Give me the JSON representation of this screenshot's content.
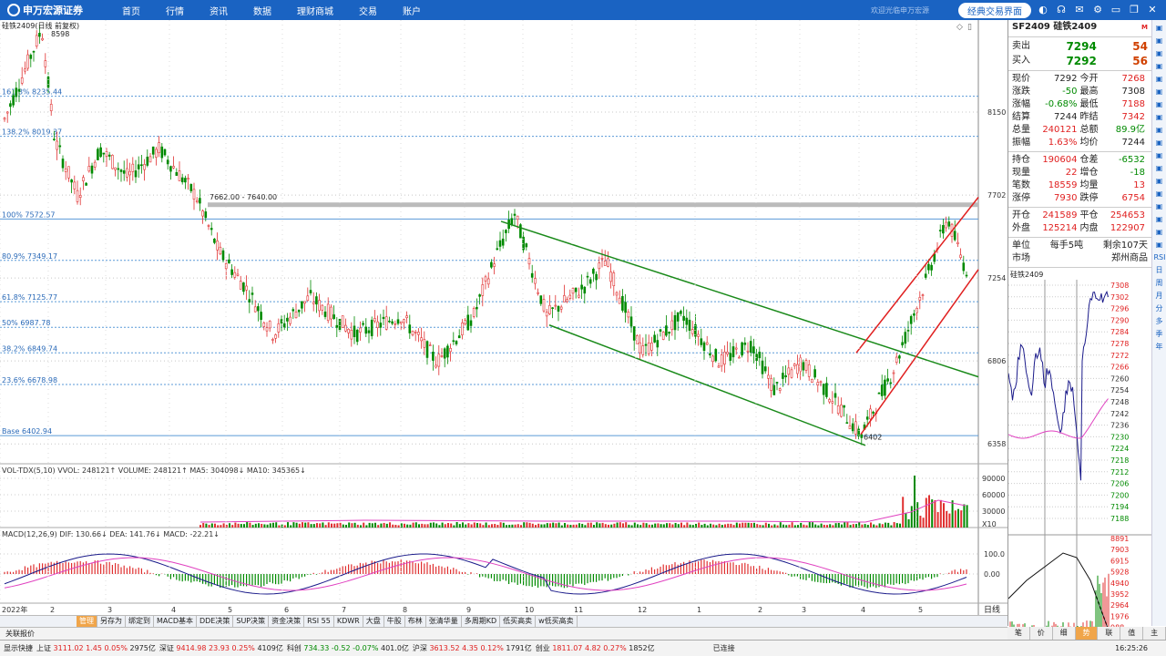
{
  "app": {
    "logo_text": "申万宏源证券",
    "nav": [
      "首页",
      "行情",
      "资讯",
      "数据",
      "理财商城",
      "交易",
      "账户"
    ],
    "welcome": "欢迎光临申万宏源",
    "classic_btn": "经典交易界面"
  },
  "chart": {
    "title": "硅铁2409(日线 前复权)",
    "high_label": "8598",
    "low_label": "6402",
    "zone_label": "7662.00 - 7640.00",
    "fib": [
      {
        "label": "161.8% 8235.44",
        "value": 8235.44
      },
      {
        "label": "138.2% 8019.37",
        "value": 8019.37
      },
      {
        "label": "100% 7572.57",
        "value": 7572.57
      },
      {
        "label": "80.9% 7349.17",
        "value": 7349.17
      },
      {
        "label": "61.8% 7125.77",
        "value": 7125.77
      },
      {
        "label": "50% 6987.78",
        "value": 6987.78
      },
      {
        "label": "38.2% 6849.74",
        "value": 6849.74
      },
      {
        "label": "23.6% 6678.98",
        "value": 6678.98
      },
      {
        "label": "Base 6402.94",
        "value": 6402.94
      }
    ],
    "y_ticks": [
      "8150",
      "7702",
      "7254",
      "6806",
      "6358"
    ],
    "vol_title": "VOL-TDX(5,10) VVOL: 248121↑ VOLUME: 248121↑ MA5: 304098↓ MA10: 345365↓",
    "vol_ticks": [
      "90000",
      "60000",
      "30000",
      "X10"
    ],
    "macd_title": "MACD(12,26,9) DIF: 130.66↓ DEA: 141.76↓ MACD: -22.21↓",
    "macd_ticks": [
      "100.0",
      "0.00"
    ],
    "x_labels": [
      "2022年",
      "2",
      "3",
      "4",
      "5",
      "6",
      "7",
      "8",
      "9",
      "10",
      "11",
      "12",
      "1",
      "2",
      "3",
      "4",
      "5"
    ],
    "period": "日线"
  },
  "quote": {
    "code": "SF2409 硅铁2409",
    "sell_label": "卖出",
    "sell_price": "7294",
    "sell_vol": "54",
    "buy_label": "买入",
    "buy_price": "7292",
    "buy_vol": "56",
    "rows1": [
      [
        "现价",
        "7292",
        "今开",
        "7268"
      ],
      [
        "涨跌",
        "-50",
        "最高",
        "7308"
      ],
      [
        "涨幅",
        "-0.68%",
        "最低",
        "7188"
      ],
      [
        "结算",
        "7244",
        "昨结",
        "7342"
      ],
      [
        "总量",
        "240121",
        "总额",
        "89.9亿"
      ],
      [
        "振幅",
        "1.63%",
        "均价",
        "7244"
      ]
    ],
    "rows2": [
      [
        "持仓",
        "190604",
        "仓差",
        "-6532"
      ],
      [
        "现量",
        "22",
        "增仓",
        "-18"
      ],
      [
        "笔数",
        "18559",
        "均量",
        "13"
      ],
      [
        "涨停",
        "7930",
        "跌停",
        "6754"
      ]
    ],
    "rows3": [
      [
        "开仓",
        "241589",
        "平仓",
        "254653"
      ],
      [
        "外盘",
        "125214",
        "内盘",
        "122907"
      ]
    ],
    "unit_label": "单位",
    "unit_value": "每手5吨",
    "remain": "剩余107天",
    "market_label": "市场",
    "market_value": "郑州商品",
    "mini_title": "硅铁2409",
    "mini_ticks": [
      "7308",
      "7302",
      "7296",
      "7290",
      "7284",
      "7278",
      "7272",
      "7266",
      "7260",
      "7254",
      "7248",
      "7242",
      "7236",
      "7230",
      "7224",
      "7218",
      "7212",
      "7206",
      "7200",
      "7194",
      "7188"
    ],
    "mini_vol_ticks": [
      "8891",
      "7903",
      "6915",
      "5928",
      "4940",
      "3952",
      "2964",
      "1976",
      "988"
    ]
  },
  "tabs": [
    "管理",
    "另存为",
    "绑定到",
    "MACD基本",
    "DDE决策",
    "SUP决策",
    "资金决策",
    "RSI 55",
    "KDWR",
    "大盘",
    "牛股",
    "布林",
    "张清华量",
    "多周期KD",
    "低买高卖",
    "w低买高卖"
  ],
  "assoc": "关联报价",
  "bottom_tabs": [
    "笔",
    "价",
    "细",
    "势",
    "联",
    "值",
    "主"
  ],
  "status": {
    "quick": "显示快捷",
    "items": [
      {
        "name": "上证",
        "v": "3111.02",
        "c": "1.45",
        "p": "0.05%",
        "a": "2975亿"
      },
      {
        "name": "深证",
        "v": "9414.98",
        "c": "23.93",
        "p": "0.25%",
        "a": "4109亿"
      },
      {
        "name": "科创",
        "v": "734.33",
        "c": "-0.52",
        "p": "-0.07%",
        "a": "401.0亿"
      },
      {
        "name": "沪深",
        "v": "3613.52",
        "c": "4.35",
        "p": "0.12%",
        "a": "1791亿"
      },
      {
        "name": "创业",
        "v": "1811.07",
        "c": "4.82",
        "p": "0.27%",
        "a": "1852亿"
      }
    ],
    "connected": "已连接",
    "time": "16:25:26"
  },
  "side_icons": [
    "RSI",
    "日",
    "周",
    "月",
    "分",
    "多",
    "季",
    "年"
  ]
}
